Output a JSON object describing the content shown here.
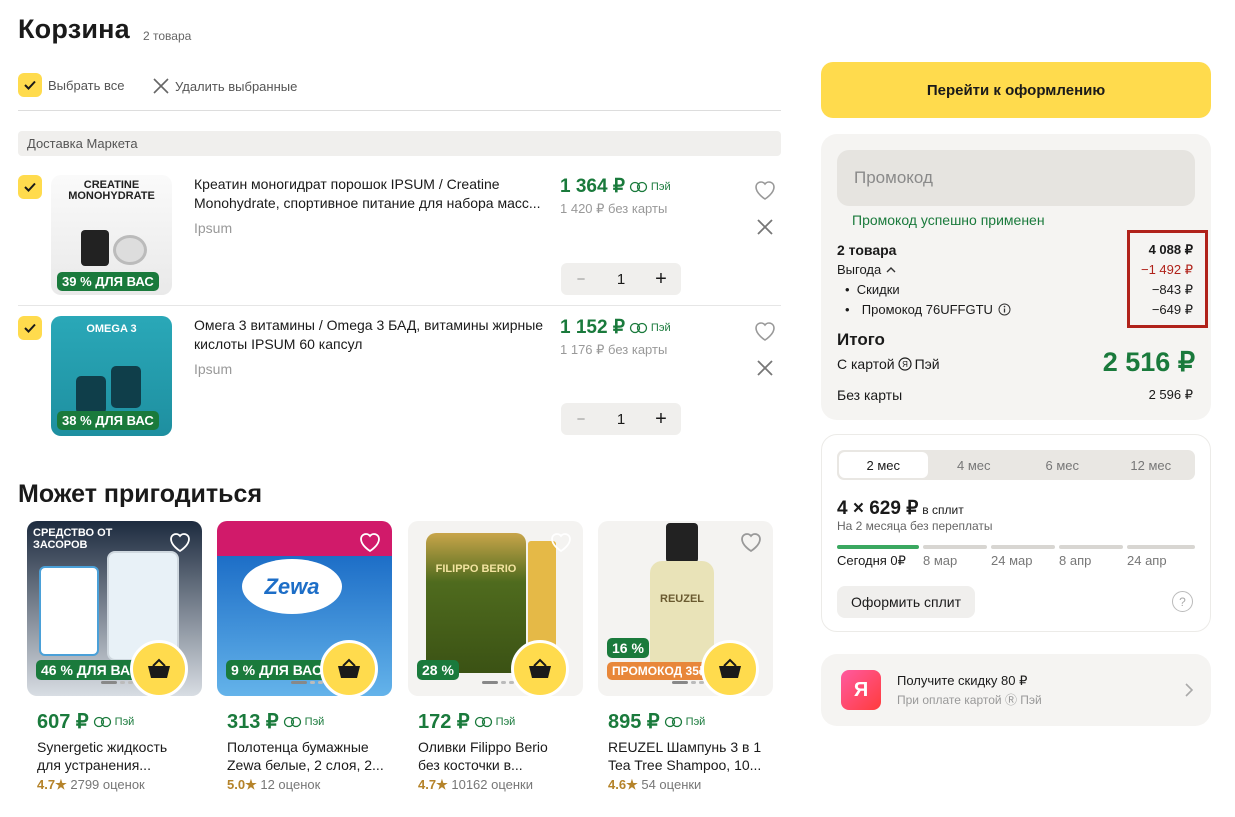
{
  "cart": {
    "title": "Корзина",
    "count": "2 товара",
    "select_all": "Выбрать все",
    "delete_selected": "Удалить выбранные",
    "delivery": "Доставка Маркета",
    "items": [
      {
        "name": "Креатин моногидрат порошок IPSUM / Creatine Monohydrate, спортивное питание для набора масс...",
        "brand": "Ipsum",
        "price": "1 364 ₽",
        "pay": "Пэй",
        "old_price": "1 420 ₽ без карты",
        "qty": "1",
        "badge": "39 % ДЛЯ ВАС",
        "img_title": "CREATINE MONOHYDRATE"
      },
      {
        "name": "Омега 3 витамины / Omega 3 БАД, витамины жирные кислоты IPSUM 60 капсул",
        "brand": "Ipsum",
        "price": "1 152 ₽",
        "pay": "Пэй",
        "old_price": "1 176 ₽ без карты",
        "qty": "1",
        "badge": "38 % ДЛЯ ВАС",
        "img_title": "OMEGA 3"
      }
    ]
  },
  "recommend": {
    "title": "Может пригодиться",
    "cards": [
      {
        "price": "607 ₽",
        "pay": "Пэй",
        "name1": "Synergetic жидкость",
        "name2": "для устранения...",
        "rating": "4.7",
        "reviews": "2799 оценок",
        "badge": "46 % ДЛЯ ВАС",
        "img_text": "СРЕДСТВО ОТ ЗАСОРОВ"
      },
      {
        "price": "313 ₽",
        "pay": "Пэй",
        "name1": "Полотенца бумажные",
        "name2": "Zewa белые, 2 слоя, 2...",
        "rating": "5.0",
        "reviews": "12 оценок",
        "badge": "9 % ДЛЯ ВАС",
        "img_text": "Zewa"
      },
      {
        "price": "172 ₽",
        "pay": "Пэй",
        "name1": "Оливки Filippo Berio",
        "name2": "без косточки в...",
        "rating": "4.7",
        "reviews": "10162 оценки",
        "badge": "28 %",
        "img_text": "FILIPPO BERIO"
      },
      {
        "price": "895 ₽",
        "pay": "Пэй",
        "name1": "REUZEL Шампунь 3 в 1",
        "name2": "Tea Tree Shampoo, 10...",
        "rating": "4.6",
        "reviews": "54 оценки",
        "badge": "16 %",
        "badge2": "ПРОМОКОД 35₽",
        "img_text": "REUZEL"
      }
    ]
  },
  "summary": {
    "checkout": "Перейти к оформлению",
    "promo_placeholder": "Промокод",
    "promo_ok": "Промокод успешно применен",
    "goods_label": "2 товара",
    "goods_value": "4 088 ₽",
    "benefit_label": "Выгода",
    "benefit_value": "−1 492 ₽",
    "discounts_label": "Скидки",
    "discounts_value": "−843 ₽",
    "promocode_label": "Промокод 76UFFGTU",
    "promocode_value": "−649 ₽",
    "total_label": "Итого",
    "card_label": "С картой",
    "card_pay": "Пэй",
    "card_total": "2 516 ₽",
    "nocard_label": "Без карты",
    "nocard_total": "2 596 ₽"
  },
  "split": {
    "tabs": [
      "2 мес",
      "4 мес",
      "6 мес",
      "12 мес"
    ],
    "active_tab": 0,
    "amount": "4 × 629 ₽",
    "amount_suffix": "в сплит",
    "note": "На 2 месяца без переплаты",
    "schedule": [
      "Сегодня 0₽",
      "8 мар",
      "24 мар",
      "8 апр",
      "24 апр"
    ],
    "button": "Оформить сплит",
    "help": "?"
  },
  "promo_banner": {
    "logo": "Я",
    "title": "Получите скидку 80 ₽",
    "subtitle": "При оплате картой",
    "subtitle_pay": "Пэй"
  },
  "colors": {
    "accent": "#ffdb4d",
    "price_green": "#1a7a3c",
    "red": "#b0221a"
  }
}
